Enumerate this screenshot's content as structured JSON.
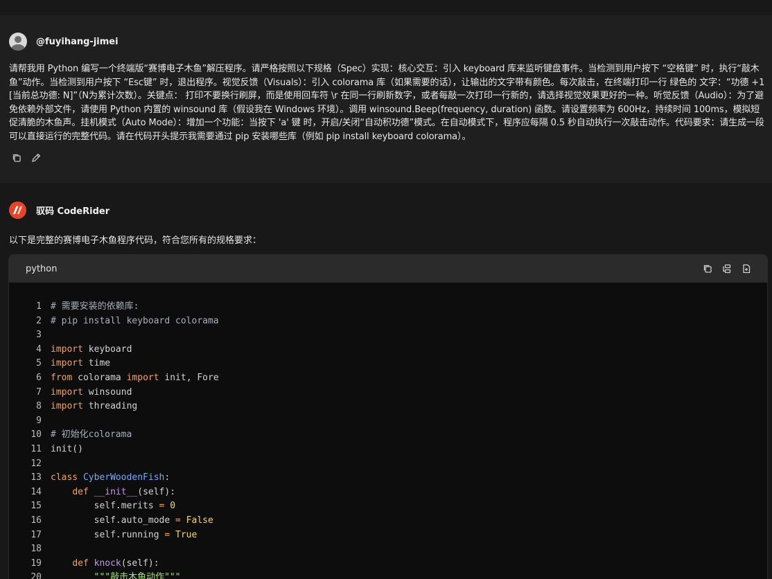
{
  "user": {
    "name": "@fuyihang-jimei",
    "message": "请帮我用 Python 编写一个终端版“赛博电子木鱼”解压程序。请严格按照以下规格（Spec）实现：核心交互：引入 keyboard 库来监听键盘事件。当检测到用户按下 “空格键” 时，执行“敲木鱼”动作。当检测到用户按下 “Esc键” 时，退出程序。视觉反馈（Visuals）：引入 colorama 库（如果需要的话），让输出的文字带有颜色。每次敲击，在终端打印一行 绿色的 文字：“功德 +1 [当前总功德: N]”（N为累计次数）。关键点： 打印不要换行刷屏，而是使用回车符 \\r 在同一行刷新数字，或者每敲一次打印一行新的，请选择视觉效果更好的一种。听觉反馈（Audio）：为了避免依赖外部文件，请使用 Python 内置的 winsound 库（假设我在 Windows 环境）。调用 winsound.Beep(frequency, duration) 函数。请设置频率为 600Hz，持续时间 100ms，模拟短促清脆的木鱼声。挂机模式（Auto Mode）：增加一个功能：当按下 'a' 键 时，开启/关闭“自动积功德”模式。在自动模式下，程序应每隔 0.5 秒自动执行一次敲击动作。代码要求：请生成一段可以直接运行的完整代码。请在代码开头提示我需要通过 pip 安装哪些库（例如 pip install keyboard colorama）。",
    "actions": [
      "copy-icon",
      "edit-icon"
    ]
  },
  "bot": {
    "name": "驭码 CodeRider",
    "intro": "以下是完整的赛博电子木鱼程序代码，符合您所有的规格要求：",
    "logo_colors": [
      "#ff6a3d",
      "#c8102e"
    ]
  },
  "code": {
    "language": "python",
    "tools": [
      "copy-icon",
      "wrap-icon",
      "insert-icon"
    ],
    "lines": [
      {
        "n": "1",
        "tokens": [
          {
            "t": "# 需要安装的依赖库:",
            "c": "cm"
          }
        ]
      },
      {
        "n": "2",
        "tokens": [
          {
            "t": "# pip install keyboard colorama",
            "c": "cm"
          }
        ]
      },
      {
        "n": "3",
        "tokens": []
      },
      {
        "n": "4",
        "tokens": [
          {
            "t": "import",
            "c": "kw"
          },
          {
            "t": " keyboard",
            "c": ""
          }
        ]
      },
      {
        "n": "5",
        "tokens": [
          {
            "t": "import",
            "c": "kw"
          },
          {
            "t": " time",
            "c": ""
          }
        ]
      },
      {
        "n": "6",
        "tokens": [
          {
            "t": "from",
            "c": "kw"
          },
          {
            "t": " colorama ",
            "c": ""
          },
          {
            "t": "import",
            "c": "kw"
          },
          {
            "t": " init, Fore",
            "c": ""
          }
        ]
      },
      {
        "n": "7",
        "tokens": [
          {
            "t": "import",
            "c": "kw"
          },
          {
            "t": " winsound",
            "c": ""
          }
        ]
      },
      {
        "n": "8",
        "tokens": [
          {
            "t": "import",
            "c": "kw"
          },
          {
            "t": " threading",
            "c": ""
          }
        ]
      },
      {
        "n": "9",
        "tokens": []
      },
      {
        "n": "10",
        "tokens": [
          {
            "t": "# 初始化colorama",
            "c": "cm"
          }
        ]
      },
      {
        "n": "11",
        "tokens": [
          {
            "t": "init()",
            "c": ""
          }
        ]
      },
      {
        "n": "12",
        "tokens": []
      },
      {
        "n": "13",
        "tokens": [
          {
            "t": "class",
            "c": "kw"
          },
          {
            "t": " ",
            "c": ""
          },
          {
            "t": "CyberWoodenFish",
            "c": "cls"
          },
          {
            "t": ":",
            "c": ""
          }
        ]
      },
      {
        "n": "14",
        "tokens": [
          {
            "t": "    ",
            "c": ""
          },
          {
            "t": "def",
            "c": "kw"
          },
          {
            "t": " ",
            "c": ""
          },
          {
            "t": "__init__",
            "c": "fn"
          },
          {
            "t": "(self):",
            "c": ""
          }
        ]
      },
      {
        "n": "15",
        "tokens": [
          {
            "t": "        self.merits ",
            "c": ""
          },
          {
            "t": "=",
            "c": "op"
          },
          {
            "t": " ",
            "c": ""
          },
          {
            "t": "0",
            "c": "num"
          }
        ]
      },
      {
        "n": "16",
        "tokens": [
          {
            "t": "        self.auto_mode ",
            "c": ""
          },
          {
            "t": "=",
            "c": "op"
          },
          {
            "t": " ",
            "c": ""
          },
          {
            "t": "False",
            "c": "bool"
          }
        ]
      },
      {
        "n": "17",
        "tokens": [
          {
            "t": "        self.running ",
            "c": ""
          },
          {
            "t": "=",
            "c": "op"
          },
          {
            "t": " ",
            "c": ""
          },
          {
            "t": "True",
            "c": "bool"
          }
        ]
      },
      {
        "n": "18",
        "tokens": []
      },
      {
        "n": "19",
        "tokens": [
          {
            "t": "    ",
            "c": ""
          },
          {
            "t": "def",
            "c": "kw"
          },
          {
            "t": " ",
            "c": ""
          },
          {
            "t": "knock",
            "c": "fn"
          },
          {
            "t": "(self):",
            "c": ""
          }
        ]
      },
      {
        "n": "20",
        "tokens": [
          {
            "t": "        ",
            "c": ""
          },
          {
            "t": "\"\"\"敲击木鱼动作\"\"\"",
            "c": "str"
          }
        ]
      }
    ]
  }
}
